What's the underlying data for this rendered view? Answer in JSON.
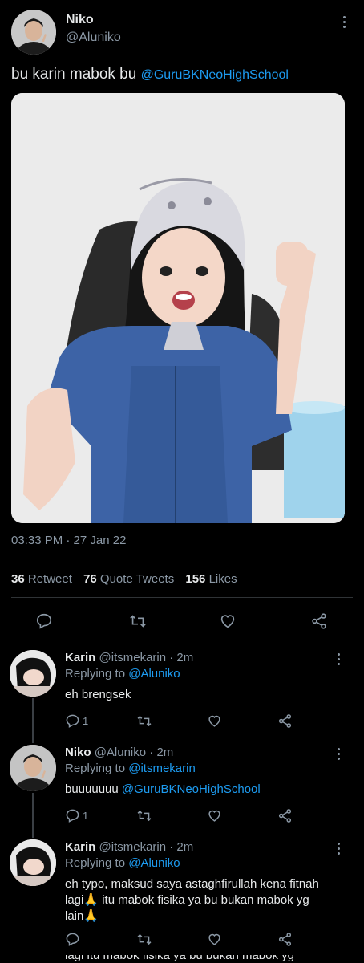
{
  "main_tweet": {
    "display_name": "Niko",
    "handle": "@Aluniko",
    "text_plain": "bu karin mabok bu",
    "text_mention": "@GuruBKNeoHighSchool",
    "timestamp": "03:33 PM · 27 Jan 22",
    "stats": {
      "retweets_count": "36",
      "retweets_label": "Retweet",
      "quotes_count": "76",
      "quotes_label": "Quote Tweets",
      "likes_count": "156",
      "likes_label": "Likes"
    }
  },
  "replies": [
    {
      "display_name": "Karin",
      "meta": "@itsmekarin · 2m",
      "replying_label": "Replying to",
      "replying_to": "@Aluniko",
      "text": "eh brengsek",
      "reply_count": "1"
    },
    {
      "display_name": "Niko",
      "meta": "@Aluniko · 2m",
      "replying_label": "Replying to",
      "replying_to": "@itsmekarin",
      "text_plain": "buuuuuuu",
      "text_mention": "@GuruBKNeoHighSchool",
      "reply_count": "1"
    },
    {
      "display_name": "Karin",
      "meta": "@itsmekarin · 2m",
      "replying_label": "Replying to",
      "replying_to": "@Aluniko",
      "text_line1": "eh typo, maksud saya astaghfirullah kena fitnah",
      "text_line2_a": "lagi",
      "text_line2_b": " itu mabok fisika ya bu bukan mabok yg",
      "text_line3": "lain",
      "emoji": "🙏"
    }
  ],
  "overflow_text": "lagi  itu mabok fisika ya bu bukan mabok yg",
  "colors": {
    "background": "#000000",
    "text": "#e7e9ea",
    "muted": "#8b98a5",
    "link": "#1d9bf0",
    "divider": "#2f3336"
  }
}
